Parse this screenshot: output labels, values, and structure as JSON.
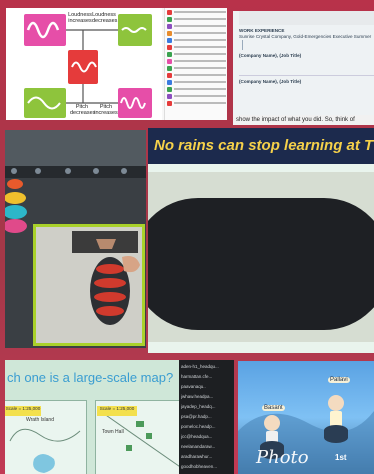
{
  "collage": {
    "background": "#b8324a",
    "accent": "#3fb46a"
  },
  "slide_a": {
    "labels": {
      "loud_up": "Loudness increases",
      "loud_down": "Loudness decreases",
      "pitch_down": "Pitch decreases",
      "pitch_up": "Pitch increases"
    }
  },
  "doc_b": {
    "heading": "WORK EXPERIENCE",
    "company1": "Sunrise Crystal Company, Gold-Emergencies Executive Summer",
    "company2": "(Company Name), (Job Title)",
    "company3": "(Company Name), (Job Title)",
    "bottom": "show the impact of what you did. So, think of"
  },
  "panel_d": {
    "title": "No rains can stop learning at TWS"
  },
  "panel_e": {
    "question": "ch one is a large-scale map?",
    "scale_left": "Scale = 1:25,000",
    "scale_right": "Scale = 1:25,000",
    "place_left": "Wrath Island",
    "place_right": "Town Hall"
  },
  "panel_f": {
    "rows": [
      "aden-h1_headqu...",
      "harmattan.cfe...",
      "paavanaqu..",
      "jwhaw.headpa...",
      "jayadep_headq...",
      "psa@pr.hadp...",
      "pomeloc.headp...",
      "jcc@headqua...",
      "neelanandaraw...",
      "aradharawhur...",
      "goodhobheaven..."
    ]
  },
  "panel_g": {
    "name1": "Basant",
    "name2": "Pallavi",
    "photo": "Photo",
    "first": "1st"
  }
}
